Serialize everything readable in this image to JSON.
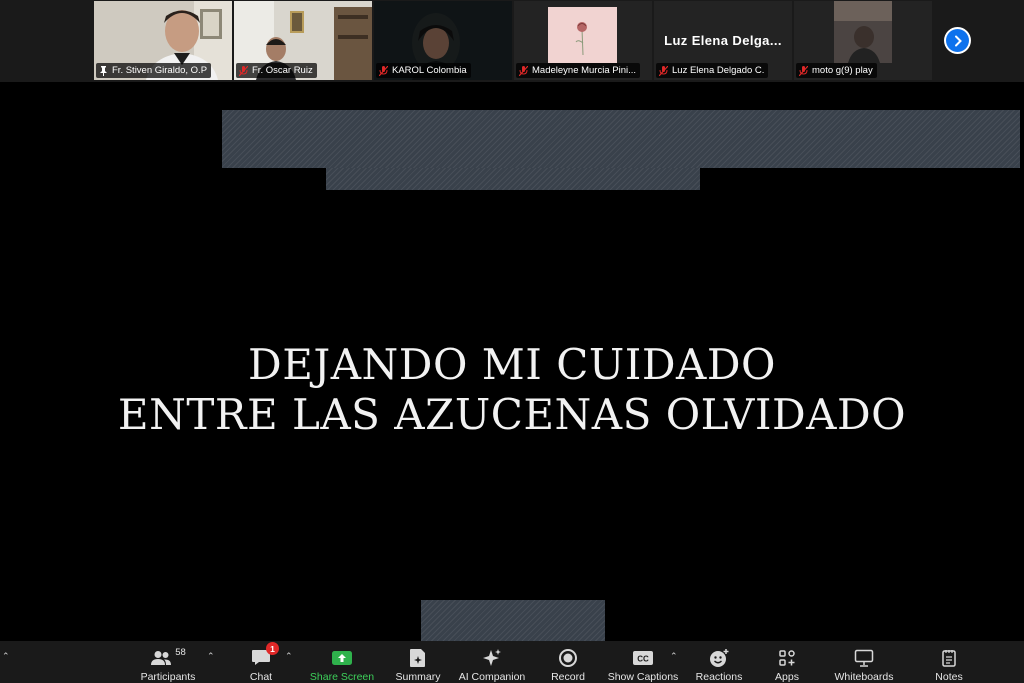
{
  "participants_strip": {
    "tiles": [
      {
        "name": "Fr. Stiven Giraldo, O.P",
        "status": "pinned",
        "video": true,
        "active_speaker": true
      },
      {
        "name": "Fr. Oscar Ruiz",
        "status": "muted",
        "video": true
      },
      {
        "name": "KAROL Colombia",
        "status": "muted",
        "video": true
      },
      {
        "name": "Madeleyne Murcia Pini...",
        "status": "muted",
        "video": false,
        "avatar": "rose-image"
      },
      {
        "name": "Luz Elena Delgado C.",
        "display_name": "Luz Elena Delga...",
        "status": "muted",
        "video": false
      },
      {
        "name": "moto g(9) play",
        "status": "muted",
        "video": true
      }
    ],
    "next_page_icon": "chevron-right-icon"
  },
  "shared_slide": {
    "line1": "DEJANDO MI CUIDADO",
    "line2": "ENTRE LAS AZUCENAS OLVIDADO"
  },
  "toolbar": {
    "participants": {
      "label": "Participants",
      "count": "58"
    },
    "chat": {
      "label": "Chat",
      "badge": "1"
    },
    "share": {
      "label": "Share Screen"
    },
    "summary": {
      "label": "Summary"
    },
    "ai_companion": {
      "label": "AI Companion"
    },
    "record": {
      "label": "Record"
    },
    "captions": {
      "label": "Show Captions",
      "icon_text": "CC"
    },
    "reactions": {
      "label": "Reactions"
    },
    "apps": {
      "label": "Apps"
    },
    "whiteboards": {
      "label": "Whiteboards"
    },
    "notes": {
      "label": "Notes"
    }
  },
  "colors": {
    "active_speaker_border": "#2fb24c",
    "share_green": "#3dd05a",
    "badge_red": "#e02828",
    "next_button_blue": "#0e72ed",
    "slide_band": "#39414b"
  }
}
